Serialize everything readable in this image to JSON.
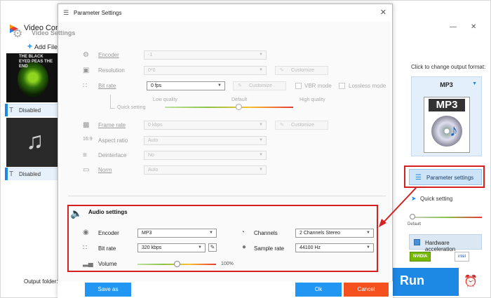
{
  "app": {
    "title": "Video Conv",
    "add_files": "Add Files",
    "items": [
      {
        "subtitle": "Disabled",
        "thumb_text": "THE BLACK EYED PEAS THE END"
      },
      {
        "subtitle": "Disabled"
      }
    ],
    "output_label": "Click to change output format:",
    "output_format": "MP3",
    "param_button": "Parameter settings",
    "quick_setting": "Quick setting",
    "mini_default": "Default",
    "hw_accel": "Hardware acceleration",
    "chips": [
      "NVIDIA",
      "intel"
    ],
    "run": "Run",
    "output_folder": "Output folder:"
  },
  "dialog": {
    "title": "Parameter Settings",
    "video": {
      "title": "Video Settings",
      "rows": [
        {
          "label": "Encoder",
          "value": "-1"
        },
        {
          "label": "Resolution",
          "value": "0*0",
          "customize": "Customize"
        },
        {
          "label": "Bit rate",
          "value": "0 fps",
          "customize": "Customize",
          "vbr": "VBR mode",
          "lossless": "Lossless mode"
        },
        {
          "label": "Frame rate",
          "value": "0 kbps",
          "customize": "Customize"
        },
        {
          "label": "Aspect ratio",
          "value": "Auto"
        },
        {
          "label": "Deinterlace",
          "value": "No"
        },
        {
          "label": "Norm",
          "value": "Auto"
        }
      ],
      "quick_setting": "Quick setting",
      "quality": {
        "low": "Low quality",
        "default": "Default",
        "high": "High quality",
        "level": 0.55
      }
    },
    "audio": {
      "title": "Audio settings",
      "encoder_label": "Encoder",
      "encoder": "MP3",
      "channels_label": "Channels",
      "channels": "2 Channels Stereo",
      "bitrate_label": "Bit rate",
      "bitrate": "320 kbps",
      "samplerate_label": "Sample rate",
      "samplerate": "44100 Hz",
      "volume_label": "Volume",
      "volume": "100%"
    },
    "buttons": {
      "save_as": "Save as",
      "ok": "Ok",
      "cancel": "Cancel"
    }
  },
  "colors": {
    "accent": "#2196f3",
    "cancel": "#f4511e",
    "highlight": "#d42020"
  }
}
